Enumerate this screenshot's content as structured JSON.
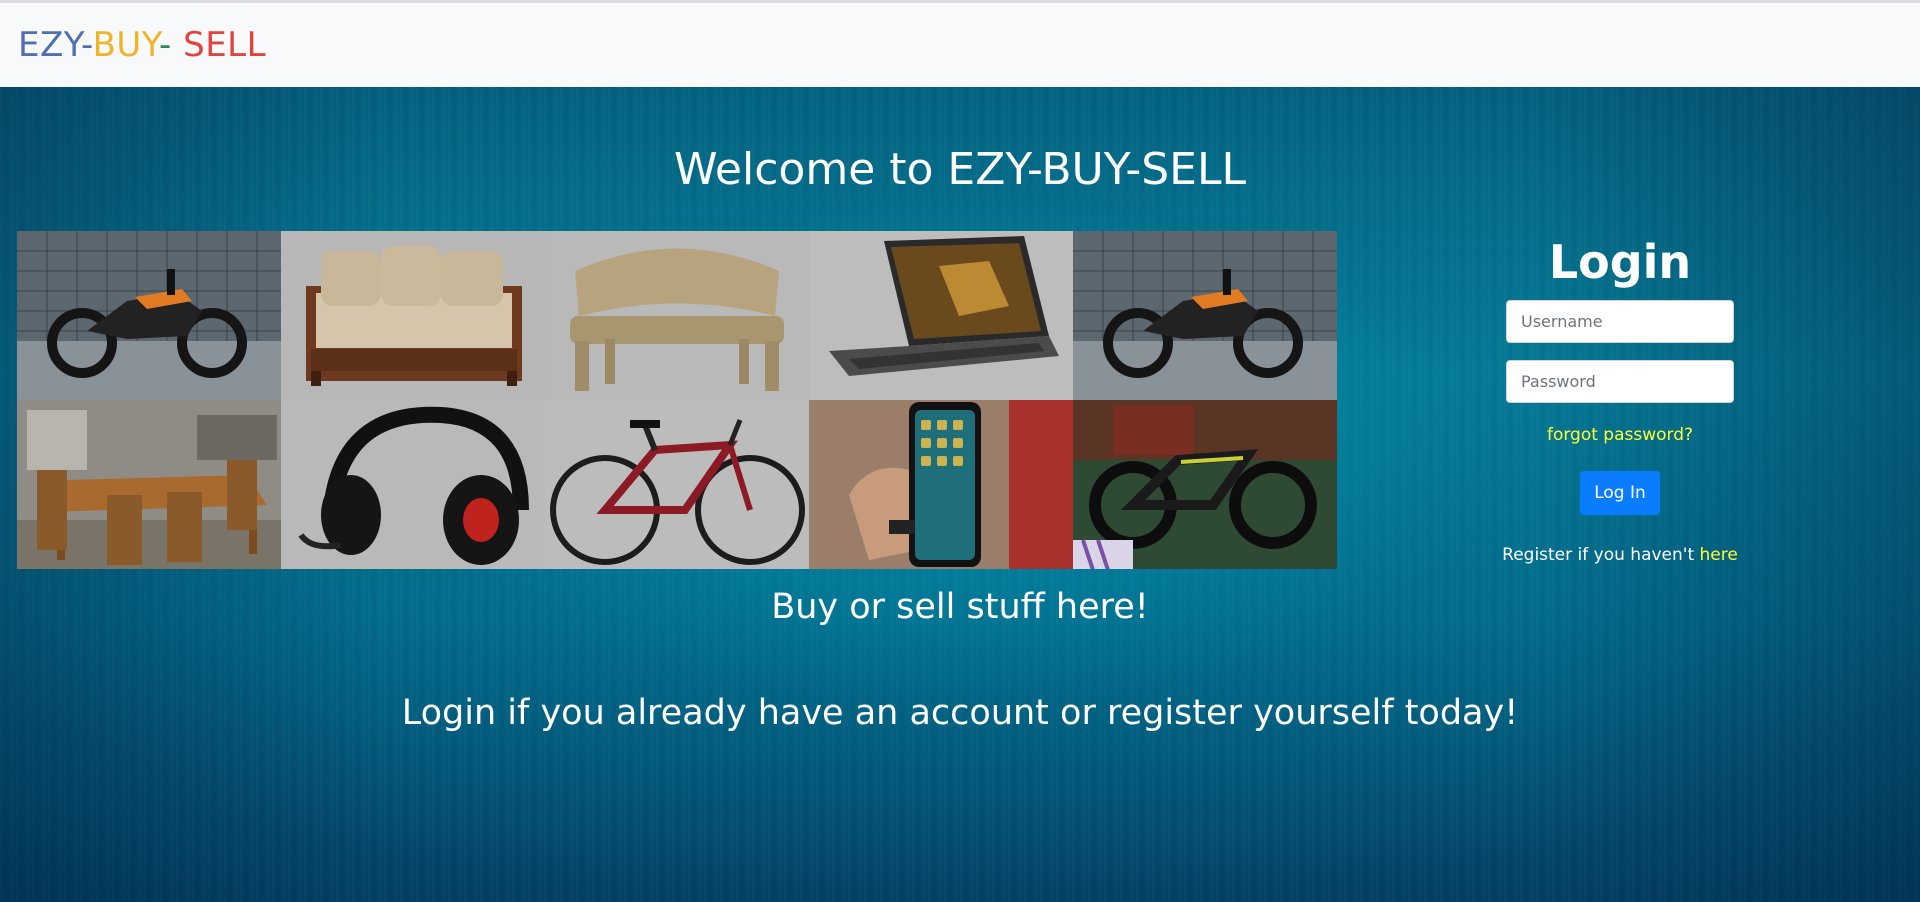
{
  "navbar": {
    "brand_parts": [
      {
        "text": "EZY",
        "color": "#4f6fb0"
      },
      {
        "text": "-",
        "color": "#4f6fb0"
      },
      {
        "text": "BUY",
        "color": "#f0b429"
      },
      {
        "text": "-",
        "color": "#2e8b57"
      },
      {
        "text": " SELL",
        "color": "#e0443e"
      }
    ]
  },
  "hero": {
    "welcome": "Welcome to EZY-BUY-SELL",
    "tagline": "Buy or sell stuff here!",
    "subline": "Login if you already have an account or register yourself today!"
  },
  "gallery": {
    "items": [
      {
        "icon": "motorcycle-image"
      },
      {
        "icon": "sofa-image"
      },
      {
        "icon": "plastic-chair-image"
      },
      {
        "icon": "laptop-image"
      },
      {
        "icon": "motorcycle-image"
      },
      {
        "icon": "dining-table-image"
      },
      {
        "icon": "headphones-image"
      },
      {
        "icon": "bicycle-image"
      },
      {
        "icon": "smartphone-image"
      },
      {
        "icon": "electric-bike-image"
      }
    ]
  },
  "login": {
    "title": "Login",
    "username_placeholder": "Username",
    "password_placeholder": "Password",
    "forgot": "forgot password?",
    "button": "Log In",
    "register_text": "Register if you haven't ",
    "register_link": "here"
  },
  "colors": {
    "link_yellow": "#ffff33",
    "button_blue": "#0a7cff",
    "navbar_bg": "#f8f9fb"
  }
}
